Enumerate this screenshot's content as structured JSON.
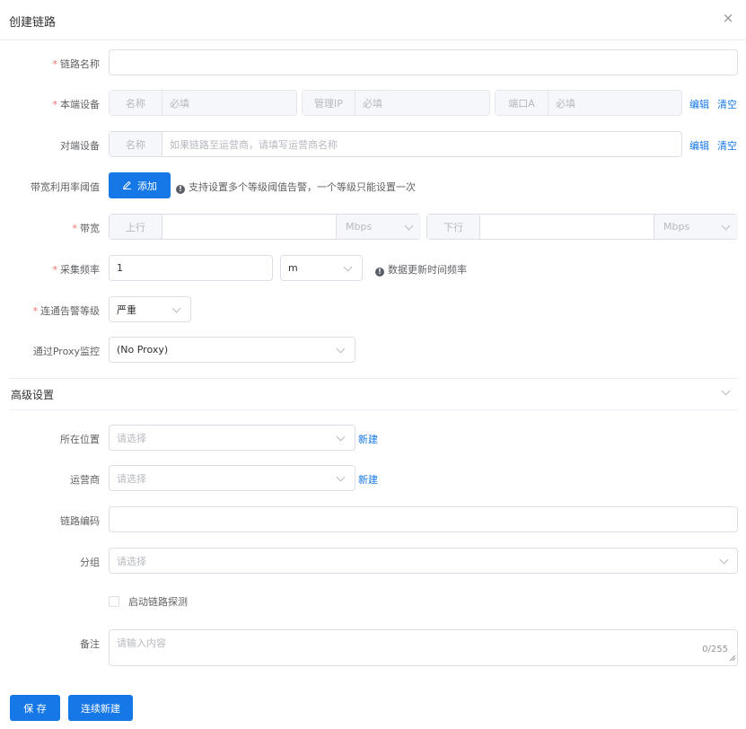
{
  "dialog": {
    "title": "创建链路",
    "close_icon": "×"
  },
  "form": {
    "link_name": {
      "label": "链路名称",
      "value": ""
    },
    "local_device": {
      "label": "本端设备",
      "name_prefix": "名称",
      "name_placeholder": "必填",
      "ip_prefix": "管理IP",
      "ip_placeholder": "必填",
      "port_prefix": "端口A",
      "port_placeholder": "必填",
      "edit": "编辑",
      "clear": "清空"
    },
    "remote_device": {
      "label": "对端设备",
      "name_prefix": "名称",
      "name_placeholder": "如果链路至运营商，请填写运营商名称",
      "edit": "编辑",
      "clear": "清空"
    },
    "threshold": {
      "label": "带宽利用率阈值",
      "add_label": "添加",
      "hint": "支持设置多个等级阈值告警，一个等级只能设置一次"
    },
    "bandwidth": {
      "label": "带宽",
      "up_prefix": "上行",
      "up_unit": "Mbps",
      "down_prefix": "下行",
      "down_unit": "Mbps"
    },
    "frequency": {
      "label": "采集频率",
      "value": "1",
      "unit": "m",
      "hint": "数据更新时间频率"
    },
    "alarm_level": {
      "label": "连通告警等级",
      "value": "严重"
    },
    "proxy": {
      "label": "通过Proxy监控",
      "value": "(No Proxy)"
    }
  },
  "advanced": {
    "title": "高级设置",
    "location": {
      "label": "所在位置",
      "placeholder": "请选择",
      "new": "新建"
    },
    "carrier": {
      "label": "运营商",
      "placeholder": "请选择",
      "new": "新建"
    },
    "link_code": {
      "label": "链路编码",
      "value": ""
    },
    "group": {
      "label": "分组",
      "placeholder": "请选择"
    },
    "probe": {
      "label": "启动链路探测"
    },
    "remark": {
      "label": "备注",
      "placeholder": "请输入内容",
      "counter": "0/255"
    }
  },
  "footer": {
    "save": "保 存",
    "save_and_new": "连续新建"
  },
  "colors": {
    "primary": "#1677e6",
    "required": "#f56c6c"
  }
}
